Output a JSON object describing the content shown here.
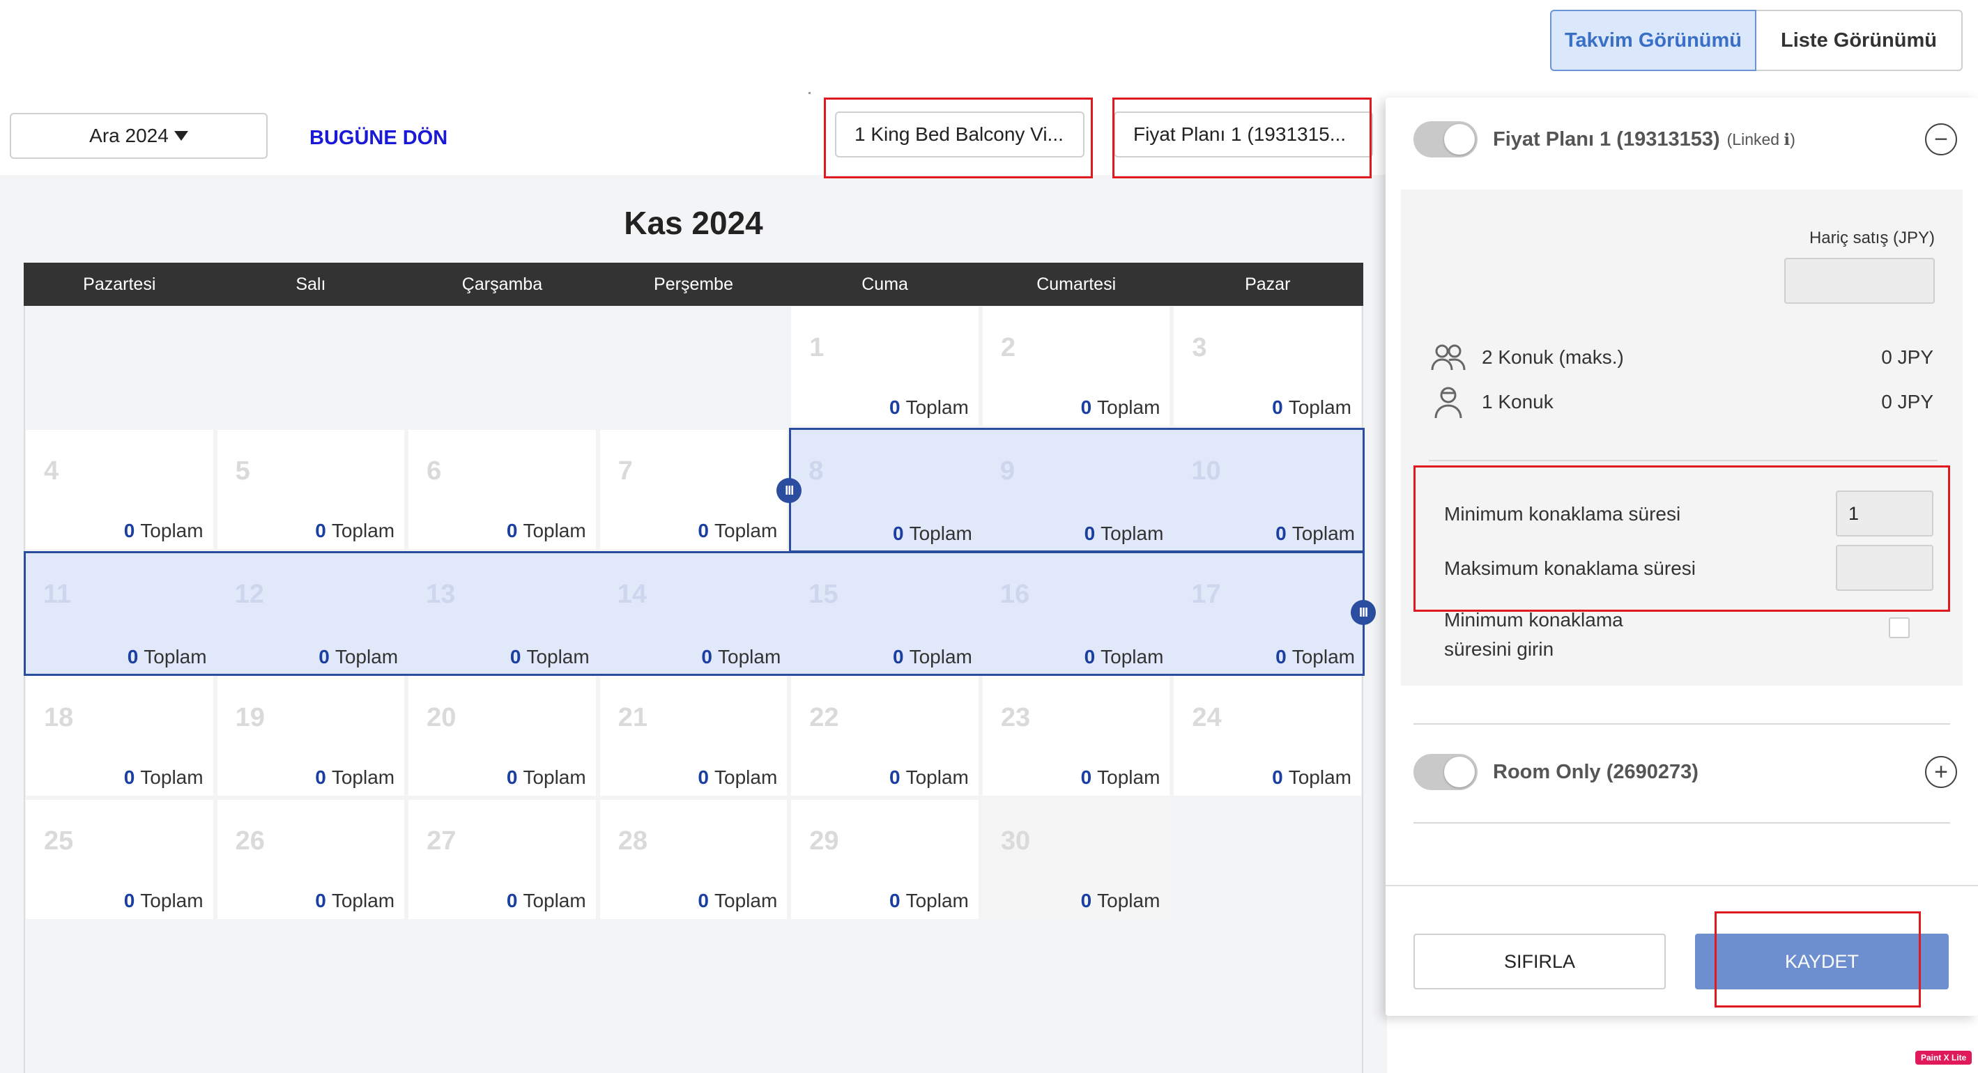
{
  "view_toggle": {
    "calendar": "Takvim Görünümü",
    "list": "Liste Görünümü"
  },
  "toolbar": {
    "month_select": "Ara 2024",
    "today_button": "BUGÜNE DÖN",
    "room_filter": "1 King Bed Balcony Vi...",
    "plan_filter": "Fiyat Planı 1 (1931315..."
  },
  "calendar": {
    "title": "Kas 2024",
    "weekdays": [
      "Pazartesi",
      "Salı",
      "Çarşamba",
      "Perşembe",
      "Cuma",
      "Cumartesi",
      "Pazar"
    ],
    "total_value": "0",
    "total_label": "Toplam",
    "days": [
      "1",
      "2",
      "3",
      "4",
      "5",
      "6",
      "7",
      "8",
      "9",
      "10",
      "11",
      "12",
      "13",
      "14",
      "15",
      "16",
      "17",
      "18",
      "19",
      "20",
      "21",
      "22",
      "23",
      "24",
      "25",
      "26",
      "27",
      "28",
      "29",
      "30"
    ],
    "selected_range": [
      "8",
      "17"
    ],
    "handle_glyph": "III"
  },
  "panel": {
    "plan1": {
      "name": "Fiyat Planı 1 (19313153)",
      "linked": "(Linked ℹ)",
      "collapse_symbol": "−"
    },
    "excl_sale_label": "Hariç satış (JPY)",
    "guests": [
      {
        "label": "2 Konuk (maks.)",
        "value": "0 JPY",
        "icon": "two-guests-icon"
      },
      {
        "label": "1 Konuk",
        "value": "0 JPY",
        "icon": "one-guest-icon"
      }
    ],
    "min_stay_label": "Minimum konaklama süresi",
    "min_stay_value": "1",
    "max_stay_label": "Maksimum konaklama süresi",
    "max_stay_value": "",
    "enter_min_stay_line1": "Minimum konaklama",
    "enter_min_stay_line2": "süresini girin",
    "plan2": {
      "name": "Room Only (2690273)",
      "expand_symbol": "+"
    },
    "reset_button": "SIFIRLA",
    "save_button": "KAYDET"
  },
  "watermark": "Paint X Lite",
  "colors": {
    "accent": "#2a4d9f",
    "selected_bg": "#e1e8fa",
    "save_button": "#6d8fd0",
    "annotation_red": "#e0191e",
    "link_blue": "#1a1ad6"
  }
}
